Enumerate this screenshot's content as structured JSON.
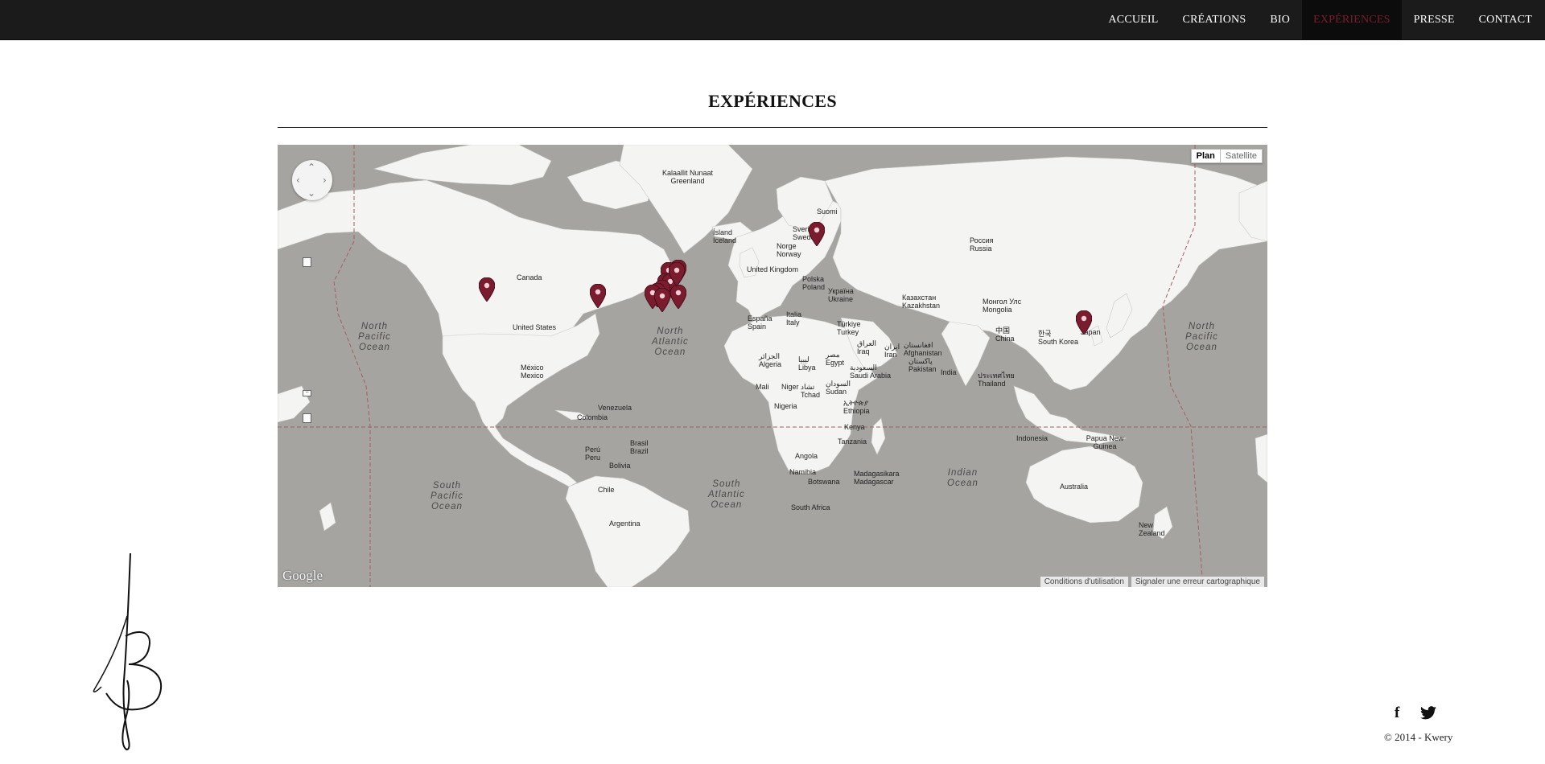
{
  "nav": {
    "items": [
      {
        "label": "ACCUEIL"
      },
      {
        "label": "CRÉATIONS"
      },
      {
        "label": "BIO"
      },
      {
        "label": "EXPÉRIENCES"
      },
      {
        "label": "PRESSE"
      },
      {
        "label": "CONTACT"
      }
    ],
    "active": "EXPÉRIENCES",
    "active_color": "#7a1c2e"
  },
  "page": {
    "title": "EXPÉRIENCES"
  },
  "map": {
    "type_control": {
      "plan": "Plan",
      "satellite": "Satellite",
      "selected": "Plan"
    },
    "logo": "Google",
    "terms_link": "Conditions d'utilisation",
    "report_link": "Signaler une erreur cartographique",
    "pin_color": "#7a1c2e",
    "pin_count": 14,
    "oceans": [
      {
        "name": "North Pacific Ocean",
        "lines": [
          "North",
          "Pacific",
          "Ocean"
        ]
      },
      {
        "name": "North Atlantic Ocean",
        "lines": [
          "North",
          "Atlantic",
          "Ocean"
        ]
      },
      {
        "name": "South Pacific Ocean",
        "lines": [
          "South",
          "Pacific",
          "Ocean"
        ]
      },
      {
        "name": "South Atlantic Ocean",
        "lines": [
          "South",
          "Atlantic",
          "Ocean"
        ]
      },
      {
        "name": "Indian Ocean",
        "lines": [
          "Indian",
          "Ocean"
        ]
      },
      {
        "name": "North Pacific Ocean (east)",
        "lines": [
          "North",
          "Pacific",
          "Ocean"
        ]
      }
    ],
    "places": [
      "Kalaallit Nunaat",
      "Greenland",
      "Ísland",
      "Iceland",
      "Suomi",
      "Sverige",
      "Sweden",
      "Norge",
      "Norway",
      "United Kingdom",
      "Polska",
      "Poland",
      "Україна",
      "Ukraine",
      "España",
      "Spain",
      "Italia",
      "Italy",
      "Türkiye",
      "Turkey",
      "Россия",
      "Russia",
      "Казахстан",
      "Kazakhstan",
      "Монгол Улс",
      "Mongolia",
      "中国",
      "China",
      "한국",
      "South Korea",
      "Japan",
      "Canada",
      "United States",
      "México",
      "Mexico",
      "Venezuela",
      "Colombia",
      "Perú",
      "Peru",
      "Brasil",
      "Brazil",
      "Bolivia",
      "Chile",
      "Argentina",
      "الجزائر",
      "Algeria",
      "ليبيا",
      "Libya",
      "مصر",
      "Egypt",
      "Mali",
      "Niger",
      "تشاد",
      "Tchad",
      "Nigeria",
      "السودان",
      "Sudan",
      "ኢትዮጵያ",
      "Ethiopia",
      "Kenya",
      "Tanzania",
      "Angola",
      "Namibia",
      "Botswana",
      "Madagasikara",
      "Madagascar",
      "South Africa",
      "العراق",
      "Iraq",
      "ایران",
      "Iran",
      "افغانستان",
      "Afghanistan",
      "پاکستان",
      "Pakistan",
      "India",
      "السعودية",
      "Saudi Arabia",
      "ประเทศไทย",
      "Thailand",
      "Indonesia",
      "Papua New Guinea",
      "Australia",
      "New Zealand"
    ]
  },
  "footer": {
    "copyright": "© 2014 - Kwery",
    "facebook": "f",
    "twitter_icon": "twitter-bird"
  }
}
